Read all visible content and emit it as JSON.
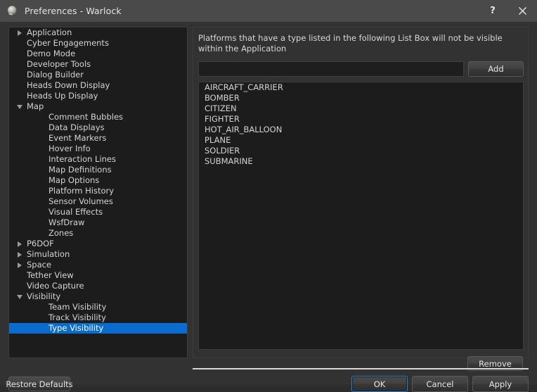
{
  "window": {
    "title": "Preferences - Warlock",
    "icon": "sphere-icon",
    "help_label": "?",
    "close_label": "×"
  },
  "sidebar": {
    "items": [
      {
        "label": "Application",
        "level": 0,
        "expander": "collapsed",
        "selected": false
      },
      {
        "label": "Cyber Engagements",
        "level": 0,
        "expander": "none",
        "selected": false
      },
      {
        "label": "Demo Mode",
        "level": 0,
        "expander": "none",
        "selected": false
      },
      {
        "label": "Developer Tools",
        "level": 0,
        "expander": "none",
        "selected": false
      },
      {
        "label": "Dialog Builder",
        "level": 0,
        "expander": "none",
        "selected": false
      },
      {
        "label": "Heads Down Display",
        "level": 0,
        "expander": "none",
        "selected": false
      },
      {
        "label": "Heads Up Display",
        "level": 0,
        "expander": "none",
        "selected": false
      },
      {
        "label": "Map",
        "level": 0,
        "expander": "expanded",
        "selected": false
      },
      {
        "label": "Comment Bubbles",
        "level": 1,
        "expander": "none",
        "selected": false
      },
      {
        "label": "Data Displays",
        "level": 1,
        "expander": "none",
        "selected": false
      },
      {
        "label": "Event Markers",
        "level": 1,
        "expander": "none",
        "selected": false
      },
      {
        "label": "Hover Info",
        "level": 1,
        "expander": "none",
        "selected": false
      },
      {
        "label": "Interaction Lines",
        "level": 1,
        "expander": "none",
        "selected": false
      },
      {
        "label": "Map Definitions",
        "level": 1,
        "expander": "none",
        "selected": false
      },
      {
        "label": "Map Options",
        "level": 1,
        "expander": "none",
        "selected": false
      },
      {
        "label": "Platform History",
        "level": 1,
        "expander": "none",
        "selected": false
      },
      {
        "label": "Sensor Volumes",
        "level": 1,
        "expander": "none",
        "selected": false
      },
      {
        "label": "Visual Effects",
        "level": 1,
        "expander": "none",
        "selected": false
      },
      {
        "label": "WsfDraw",
        "level": 1,
        "expander": "none",
        "selected": false
      },
      {
        "label": "Zones",
        "level": 1,
        "expander": "none",
        "selected": false
      },
      {
        "label": "P6DOF",
        "level": 0,
        "expander": "collapsed",
        "selected": false
      },
      {
        "label": "Simulation",
        "level": 0,
        "expander": "collapsed",
        "selected": false
      },
      {
        "label": "Space",
        "level": 0,
        "expander": "collapsed",
        "selected": false
      },
      {
        "label": "Tether View",
        "level": 0,
        "expander": "none",
        "selected": false
      },
      {
        "label": "Video Capture",
        "level": 0,
        "expander": "none",
        "selected": false
      },
      {
        "label": "Visibility",
        "level": 0,
        "expander": "expanded",
        "selected": false
      },
      {
        "label": "Team Visibility",
        "level": 1,
        "expander": "none",
        "selected": false
      },
      {
        "label": "Track Visibility",
        "level": 1,
        "expander": "none",
        "selected": false
      },
      {
        "label": "Type Visibility",
        "level": 1,
        "expander": "none",
        "selected": true
      }
    ]
  },
  "main": {
    "description": "Platforms that have a type listed in the following List Box will not be visible within the Application",
    "type_input": {
      "value": "",
      "placeholder": ""
    },
    "add_label": "Add",
    "remove_label": "Remove",
    "list_items": [
      "AIRCRAFT_CARRIER",
      "BOMBER",
      "CITIZEN",
      "FIGHTER",
      "HOT_AIR_BALLOON",
      "PLANE",
      "SOLDIER",
      "SUBMARINE"
    ]
  },
  "footer": {
    "restore_defaults_label": "Restore Defaults",
    "ok_label": "OK",
    "cancel_label": "Cancel",
    "apply_label": "Apply"
  },
  "colors": {
    "selection_blue": "#0a6cce",
    "focus_blue": "#2a7fd4",
    "titlebar": "#4a4a4a",
    "panel_bg": "#323232",
    "list_bg": "#1c1c1c",
    "text": "#d4d4d4"
  }
}
